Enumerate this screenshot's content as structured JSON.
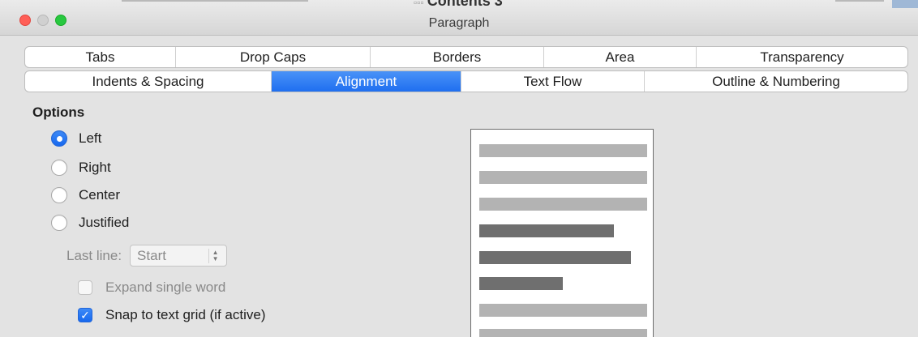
{
  "window": {
    "title": "Paragraph",
    "behind_title": "Contents 3"
  },
  "tabs": {
    "row1": [
      "Tabs",
      "Drop Caps",
      "Borders",
      "Area",
      "Transparency"
    ],
    "row2": [
      "Indents & Spacing",
      "Alignment",
      "Text Flow",
      "Outline & Numbering"
    ],
    "active": "Alignment"
  },
  "options": {
    "title": "Options",
    "radios": [
      {
        "label": "Left",
        "checked": true
      },
      {
        "label": "Right",
        "checked": false
      },
      {
        "label": "Center",
        "checked": false
      },
      {
        "label": "Justified",
        "checked": false
      }
    ],
    "last_line": {
      "label": "Last line:",
      "value": "Start"
    },
    "expand_single_word": {
      "label": "Expand single word",
      "checked": false,
      "enabled": false
    },
    "snap_to_grid": {
      "label": "Snap to text grid (if active)",
      "checked": true
    }
  },
  "colors": {
    "accent": "#1f6ff0",
    "preview_context_line": "#b3b3b3",
    "preview_paragraph_line": "#6f6f6f"
  }
}
